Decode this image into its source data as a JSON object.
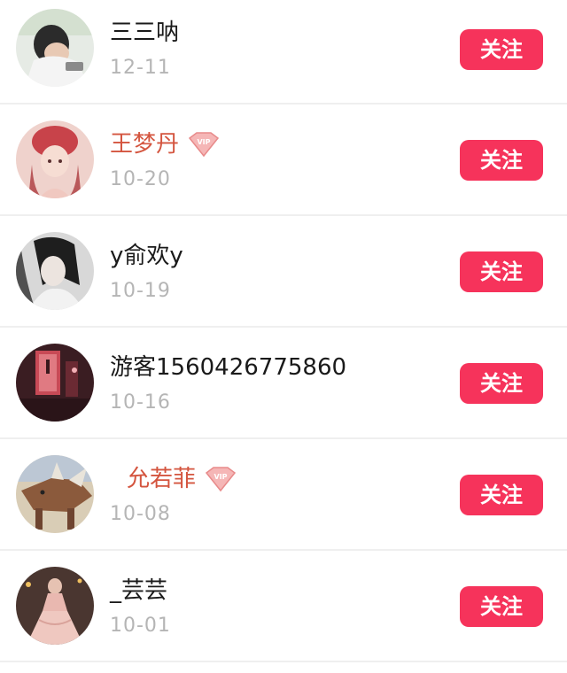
{
  "users": [
    {
      "name": "三三呐",
      "date": "12-11",
      "vip": false,
      "follow_label": "关注"
    },
    {
      "name": "王梦丹",
      "date": "10-20",
      "vip": true,
      "follow_label": "关注"
    },
    {
      "name": "y俞欢y",
      "date": "10-19",
      "vip": false,
      "follow_label": "关注"
    },
    {
      "name": "游客1560426775860",
      "date": "10-16",
      "vip": false,
      "follow_label": "关注"
    },
    {
      "name": "允若菲",
      "date": "10-08",
      "vip": true,
      "follow_label": "关注"
    },
    {
      "name": "_芸芸",
      "date": "10-01",
      "vip": false,
      "follow_label": "关注"
    }
  ],
  "badge_text": "VIP",
  "colors": {
    "follow_button": "#f6335b",
    "vip_name": "#d4553f",
    "date": "#b5b5b5",
    "divider": "#efefef"
  }
}
